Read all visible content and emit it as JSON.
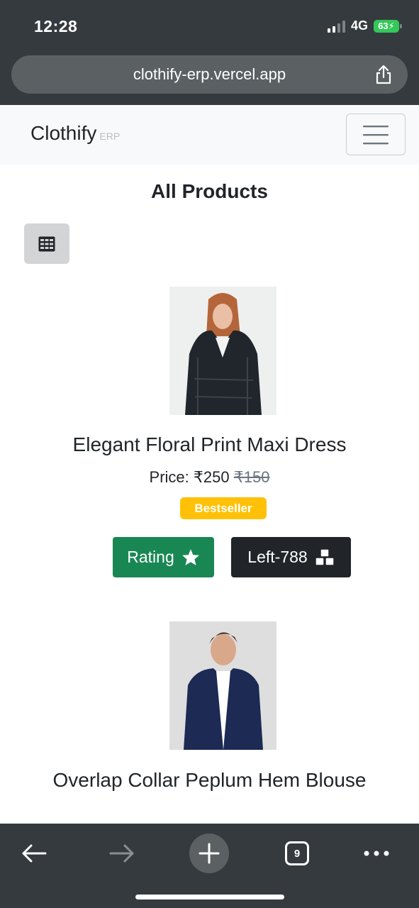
{
  "status": {
    "time": "12:28",
    "network": "4G",
    "battery": "63"
  },
  "browser": {
    "url": "clothify-erp.vercel.app",
    "tab_count": "9"
  },
  "navbar": {
    "brand": "Clothify",
    "brand_sub": "ERP"
  },
  "page": {
    "title": "All Products"
  },
  "products": [
    {
      "title": "Elegant Floral Print Maxi Dress",
      "price_label": "Price: ₹250",
      "old_price": "₹150",
      "badge": "Bestseller",
      "rating_label": "Rating",
      "stock_label": "Left-788"
    },
    {
      "title": "Overlap Collar Peplum Hem Blouse"
    }
  ],
  "icons": {
    "share": "share-icon",
    "menu": "hamburger-icon",
    "grid": "grid-icon",
    "star": "star-icon",
    "boxes": "boxes-icon",
    "back": "back-arrow-icon",
    "forward": "forward-arrow-icon",
    "new_tab": "plus-icon",
    "more": "more-icon"
  },
  "colors": {
    "success": "#198754",
    "dark": "#212529",
    "warning": "#ffc107",
    "chrome": "#353a3e"
  }
}
